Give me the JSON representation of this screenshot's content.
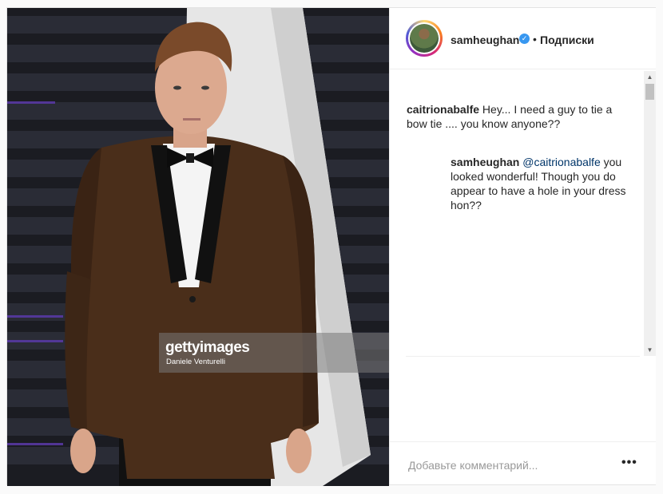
{
  "photo": {
    "watermark_brand": "gettyimages",
    "watermark_credit": "Daniele Venturelli"
  },
  "header": {
    "username": "samheughan",
    "verified_icon": "verified-badge-icon",
    "separator": "•",
    "follow_status": "Подписки"
  },
  "comments": [
    {
      "username": "caitrionabalfe",
      "text": "Hey... I need a guy to tie a bow tie .... you know anyone??"
    },
    {
      "username": "samheughan",
      "mention": "@caitrionabalfe",
      "text": "you looked wonderful! Though you do appear to have a hole in your dress hon??"
    }
  ],
  "add_comment": {
    "placeholder": "Добавьте комментарий...",
    "more_label": "•••"
  },
  "colors": {
    "verified": "#3897f0",
    "mention": "#003569",
    "text": "#262626",
    "placeholder": "#999999"
  }
}
